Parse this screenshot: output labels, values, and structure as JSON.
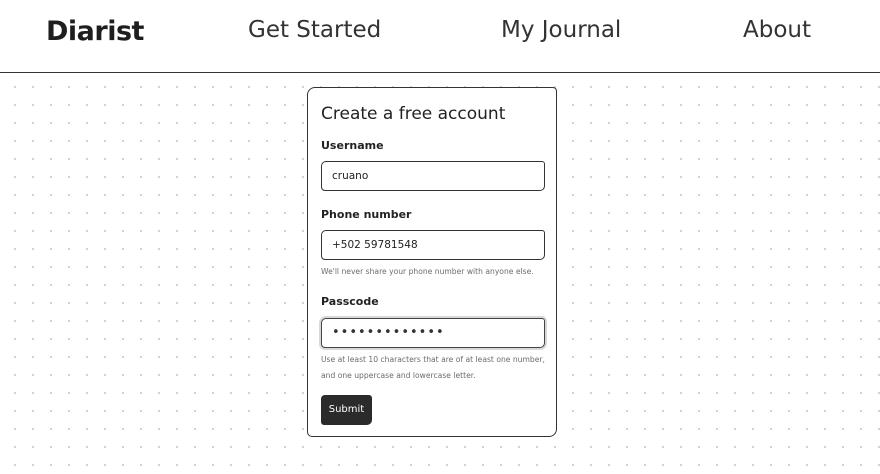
{
  "nav": {
    "brand": "Diarist",
    "links": [
      "Get Started",
      "My Journal",
      "About"
    ]
  },
  "form": {
    "title": "Create a free account",
    "username": {
      "label": "Username",
      "value": "cruano"
    },
    "phone": {
      "label": "Phone number",
      "value": "+502 59781548",
      "help": "We'll never share your phone number with anyone else."
    },
    "passcode": {
      "label": "Passcode",
      "masked_value": "•••••••••••••",
      "help": "Use at least 10 characters that are of at least one number, and one uppercase and lowercase letter."
    },
    "submit_label": "Submit"
  }
}
